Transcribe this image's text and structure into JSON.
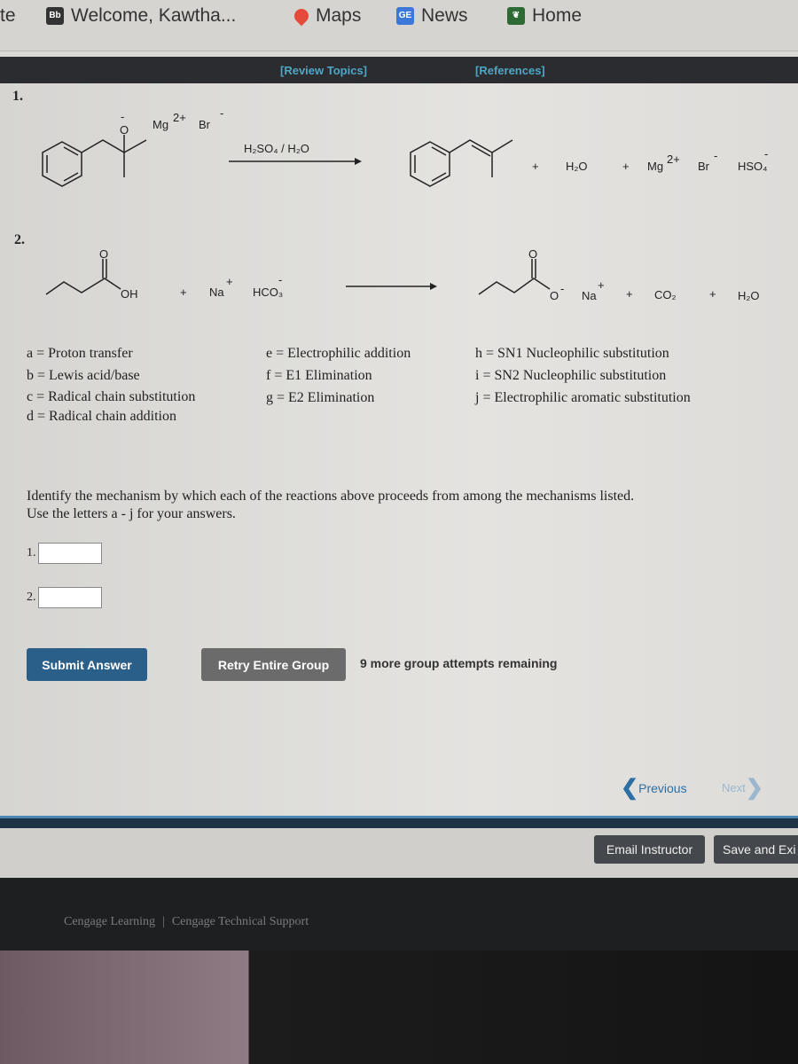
{
  "browser": {
    "bookmarks": [
      {
        "label": "te",
        "icon": "tab-fragment"
      },
      {
        "label": "Welcome, Kawtha...",
        "icon": "blackboard-icon"
      },
      {
        "label": "Maps",
        "icon": "maps-pin-icon"
      },
      {
        "label": "News",
        "icon": "google-news-icon"
      },
      {
        "label": "Home",
        "icon": "leaf-icon"
      }
    ]
  },
  "topbar": {
    "review_topics": "[Review Topics]",
    "references": "[References]"
  },
  "reactions": [
    {
      "number": "1.",
      "reactant_labels": {
        "oxygen": "O",
        "charge": "-",
        "mg": "Mg",
        "mg_charge": "2+",
        "br": "Br",
        "br_charge": "-"
      },
      "reagent": "H₂SO₄ / H₂O",
      "products": {
        "plus1": "+",
        "water": "H₂O",
        "plus2": "+",
        "mg": "Mg",
        "mg_charge": "2+",
        "br": "Br",
        "br_charge": "-",
        "hso4": "HSO₄",
        "hso4_charge": "-"
      }
    },
    {
      "number": "2.",
      "reactant_labels": {
        "oxygen": "O",
        "oh": "OH",
        "plus": "+",
        "na": "Na",
        "na_charge": "+",
        "hco3": "HCO₃",
        "hco3_charge": "-"
      },
      "products": {
        "oxygen": "O",
        "o_minus": "O",
        "o_charge": "-",
        "na": "Na",
        "na_charge": "+",
        "plus1": "+",
        "co2": "CO₂",
        "plus2": "+",
        "water": "H₂O"
      }
    }
  ],
  "mechanisms": [
    [
      "a = Proton transfer",
      "b = Lewis acid/base",
      "c = Radical chain substitution",
      "d = Radical chain addition"
    ],
    [
      "e = Electrophilic addition",
      "f = E1 Elimination",
      "g = E2 Elimination"
    ],
    [
      "h = SN1 Nucleophilic substitution",
      "i = SN2 Nucleophilic substitution",
      "j = Electrophilic aromatic substitution"
    ]
  ],
  "question": {
    "line1": "Identify the mechanism by which each of the reactions above proceeds from among the mechanisms listed.",
    "line2": "Use the letters a - j for your answers."
  },
  "answers": [
    {
      "label": "1.",
      "value": ""
    },
    {
      "label": "2.",
      "value": ""
    }
  ],
  "buttons": {
    "submit": "Submit Answer",
    "retry": "Retry Entire Group",
    "attempts": "9 more group attempts remaining"
  },
  "nav": {
    "previous": "Previous",
    "next": "Next"
  },
  "actions": {
    "email": "Email Instructor",
    "save": "Save and Exi"
  },
  "footer": {
    "cengage": "Cengage Learning",
    "separator": "|",
    "support": "Cengage Technical Support"
  },
  "colors": {
    "link": "#4fa6c6",
    "submit": "#2a5f8a",
    "retry": "#6b6b6b",
    "nav_blue": "#2d6fa3"
  }
}
